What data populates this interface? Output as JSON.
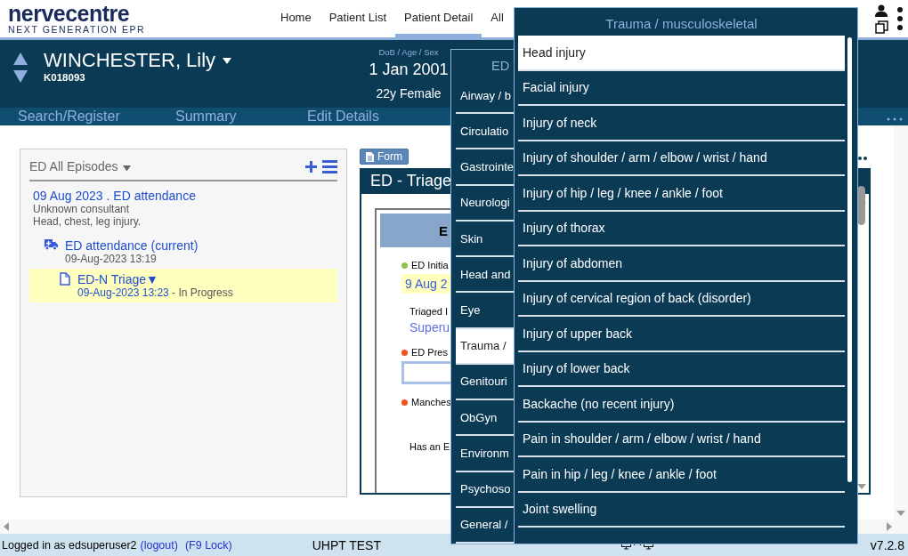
{
  "header": {
    "logo": "nervecentre",
    "tagline": "NEXT GENERATION EPR",
    "nav": [
      {
        "label": "Home",
        "selected": false
      },
      {
        "label": "Patient List",
        "selected": false
      },
      {
        "label": "Patient Detail",
        "selected": true
      },
      {
        "label": "All",
        "selected": false
      }
    ]
  },
  "patient": {
    "name": "WINCHESTER, Lily",
    "id": "K018093",
    "dob_label": "DoB / Age / Sex",
    "dob": "1 Jan 2001",
    "age_sex": "22y Female"
  },
  "patient_nav": [
    "Search/Register",
    "Summary",
    "Edit Details"
  ],
  "episodes": {
    "title": "ED All Episodes",
    "episode": {
      "title": "09 Aug 2023 . ED attendance",
      "consultant": "Unknown consultant",
      "complaint": "Head, chest, leg injury."
    },
    "items": [
      {
        "kind": "attendance",
        "title": "ED attendance (current)",
        "date": "09-Aug-2023 13:19",
        "selected": false
      },
      {
        "kind": "form",
        "title": "ED-N Triage▼",
        "date": "09-Aug-2023 13:23",
        "status": " - In Progress",
        "selected": true
      }
    ]
  },
  "form": {
    "button": "Form",
    "title": "ED - Triage",
    "section": "E",
    "fields": [
      {
        "kind": "value",
        "label": "ED Initia",
        "color": "#8bc34a",
        "value": "9 Aug 2"
      },
      {
        "kind": "link",
        "label": "Triaged I",
        "value": "Superu"
      },
      {
        "kind": "input",
        "label": "ED Pres",
        "color": "#f4511e"
      },
      {
        "kind": "label",
        "label": "Manches",
        "color": "#f4511e"
      },
      {
        "kind": "plain",
        "label": "Has an E"
      }
    ]
  },
  "category_menu": {
    "title": "ED",
    "items": [
      {
        "label": "Airway / b",
        "selected": false
      },
      {
        "label": "Circulatio",
        "selected": false
      },
      {
        "label": "Gastrointe",
        "selected": false
      },
      {
        "label": "Neurologi",
        "selected": false
      },
      {
        "label": "Skin",
        "selected": false
      },
      {
        "label": "Head and",
        "selected": false
      },
      {
        "label": "Eye",
        "selected": false
      },
      {
        "label": "Trauma /",
        "selected": true
      },
      {
        "label": "Genitouri",
        "selected": false
      },
      {
        "label": "ObGyn",
        "selected": false
      },
      {
        "label": "Environm",
        "selected": false
      },
      {
        "label": "Psychoso",
        "selected": false
      },
      {
        "label": "General /",
        "selected": false
      }
    ]
  },
  "submenu": {
    "title": "Trauma / musculoskeletal",
    "items": [
      {
        "label": "Head injury",
        "selected": true
      },
      {
        "label": "Facial injury",
        "selected": false
      },
      {
        "label": "Injury of neck",
        "selected": false
      },
      {
        "label": "Injury of shoulder / arm / elbow / wrist / hand",
        "selected": false
      },
      {
        "label": "Injury of hip / leg / knee / ankle / foot",
        "selected": false
      },
      {
        "label": "Injury of thorax",
        "selected": false
      },
      {
        "label": "Injury of abdomen",
        "selected": false
      },
      {
        "label": "Injury of cervical region of back (disorder)",
        "selected": false
      },
      {
        "label": "Injury of upper back",
        "selected": false
      },
      {
        "label": "Injury of lower back",
        "selected": false
      },
      {
        "label": "Backache (no recent injury)",
        "selected": false
      },
      {
        "label": "Pain in shoulder / arm / elbow / wrist / hand",
        "selected": false
      },
      {
        "label": "Pain in hip / leg / knee / ankle / foot",
        "selected": false
      },
      {
        "label": "Joint swelling",
        "selected": false
      }
    ]
  },
  "status_bar": {
    "user": "Logged in as edsuperuser2",
    "logout": "(logout)",
    "lock": "(F9 Lock)",
    "site": "UHPT TEST",
    "version": "v7.2.8"
  }
}
